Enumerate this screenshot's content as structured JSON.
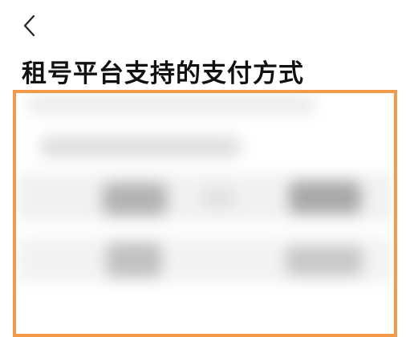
{
  "nav": {
    "back_icon": "chevron-left-icon"
  },
  "page": {
    "title": "租号平台支持的支付方式"
  },
  "highlight": {
    "border_color": "#f29a4a",
    "content_state": "blurred"
  }
}
